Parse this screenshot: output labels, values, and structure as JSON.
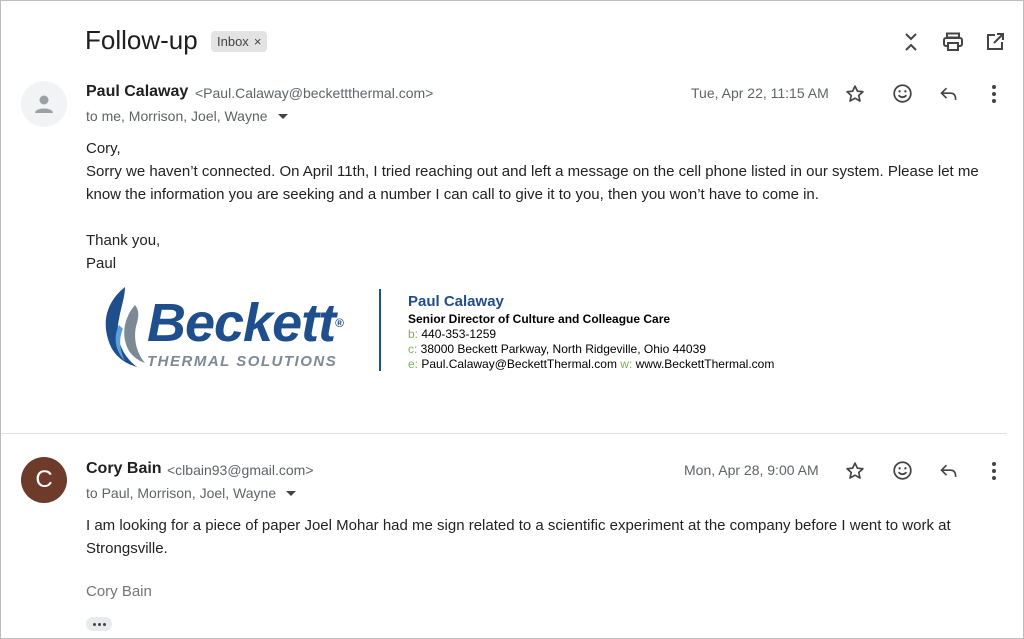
{
  "subject": "Follow-up",
  "label_chip": {
    "text": "Inbox",
    "remove": "×"
  },
  "messages": [
    {
      "sender_name": "Paul Calaway",
      "sender_email": "<Paul.Calaway@beckettthermal.com>",
      "recipients": "to me, Morrison, Joel, Wayne",
      "date": "Tue, Apr 22, 11:15 AM",
      "body": [
        "Cory,",
        "Sorry we haven’t connected.  On April 11th, I tried reaching out and left a message on the cell phone listed in our system.  Please let me",
        "know the information you are seeking and a number I can call to give it to you, then you won’t have to come in.",
        "Thank you,",
        "Paul"
      ],
      "signature": {
        "logo_word": "Beckett",
        "logo_registered": "®",
        "logo_sub": "THERMAL SOLUTIONS",
        "name": "Paul Calaway",
        "title": "Senior Director of Culture and Colleague Care",
        "b_key": "b:",
        "b_val": " 440-353-1259",
        "c_key": "c:",
        "c_val": " 38000 Beckett Parkway, North Ridgeville, Ohio 44039",
        "e_key": "e:",
        "e_val": " Paul.Calaway@BeckettThermal.com",
        "w_key": " w:",
        "w_val": " www.BeckettThermal.com"
      }
    },
    {
      "avatar_letter": "C",
      "sender_name": "Cory Bain",
      "sender_email": "<clbain93@gmail.com>",
      "recipients": "to Paul, Morrison, Joel, Wayne",
      "date": "Mon, Apr 28, 9:00 AM",
      "body": [
        "I am looking for a piece of paper Joel Mohar had me sign related to a scientific experiment at the company before I went to work at",
        "Strongsville."
      ],
      "signoff": "Cory Bain"
    }
  ],
  "colors": {
    "brand_blue": "#1f4e8c",
    "brand_green": "#7ab648",
    "avatar_brown": "#6e3b2b"
  },
  "icons": [
    "collapse-icon",
    "print-icon",
    "open-in-new-icon",
    "star-icon",
    "emoji-icon",
    "reply-icon",
    "more-vert-icon",
    "person-icon"
  ]
}
